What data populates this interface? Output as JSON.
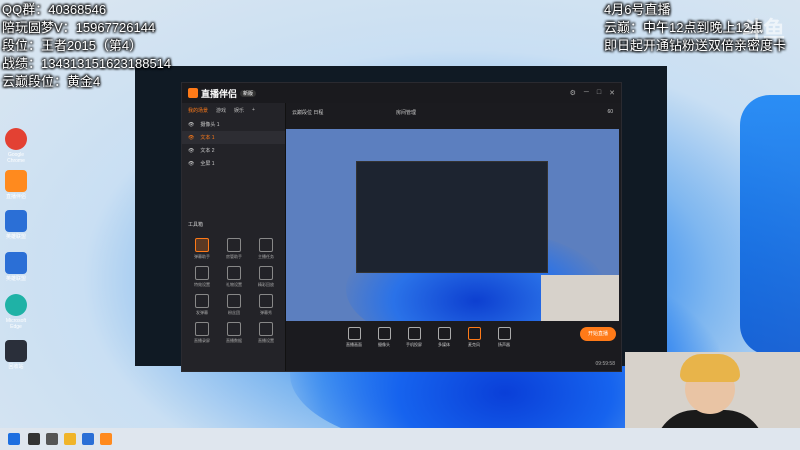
{
  "overlay": {
    "left_lines": [
      "QQ群：40368546",
      "陪玩圆梦V：15967726144",
      "段位：王者2015（第4）",
      "战绩：134313151623188514",
      "云巅段位：黄金4"
    ],
    "right_lines": [
      "4月6号直播",
      "云巅：中午12点到晚上12点",
      "即日起开通钻粉送双倍亲密度卡"
    ],
    "watermark": "斗鱼"
  },
  "desktop_icons": [
    {
      "label": "Google Chrome",
      "icon": "chrome-icon",
      "color": "#e34133"
    },
    {
      "label": "直播伴侣",
      "icon": "live-companion-icon",
      "color": "#ff8a1e"
    },
    {
      "label": "英雄联盟",
      "icon": "lol-icon",
      "color": "#2b6fd6"
    },
    {
      "label": "英雄联盟",
      "icon": "lol-icon",
      "color": "#2b6fd6"
    },
    {
      "label": "Microsoft Edge",
      "icon": "edge-icon",
      "color": "#1fb2a6"
    },
    {
      "label": "回收站",
      "icon": "recycle-bin-icon",
      "color": "#2a2f3a"
    }
  ],
  "app": {
    "title": "直播伴侣",
    "version_badge": "新版",
    "sidebar_tabs": [
      "我的场景",
      "游戏",
      "娱乐",
      "+"
    ],
    "sources": [
      {
        "name": "摄像头 1",
        "active": false
      },
      {
        "name": "文本 1",
        "active": true
      },
      {
        "name": "文本 2",
        "active": false
      },
      {
        "name": "全屏 1",
        "active": false
      }
    ],
    "tools_title": "工具箱",
    "tools": [
      "弹幕助手",
      "房管助手",
      "主播任务",
      "特效设置",
      "礼物设置",
      "精彩回放",
      "发弹幕",
      "粉丝团",
      "弹幕秀",
      "直播录屏",
      "直播数据",
      "直播设置"
    ],
    "topbar": {
      "scene_label": "云巅段位 日程",
      "room_label": "房间管理",
      "fps": "60"
    },
    "bottom_buttons": [
      "直播画面",
      "摄像头",
      "手机投屏",
      "多媒体",
      "麦克风",
      "扬声器"
    ],
    "start_live": "开始直播",
    "status_time": "09:59:58"
  },
  "colors": {
    "accent": "#ff7a18",
    "app_bg": "#1b1b1f"
  }
}
